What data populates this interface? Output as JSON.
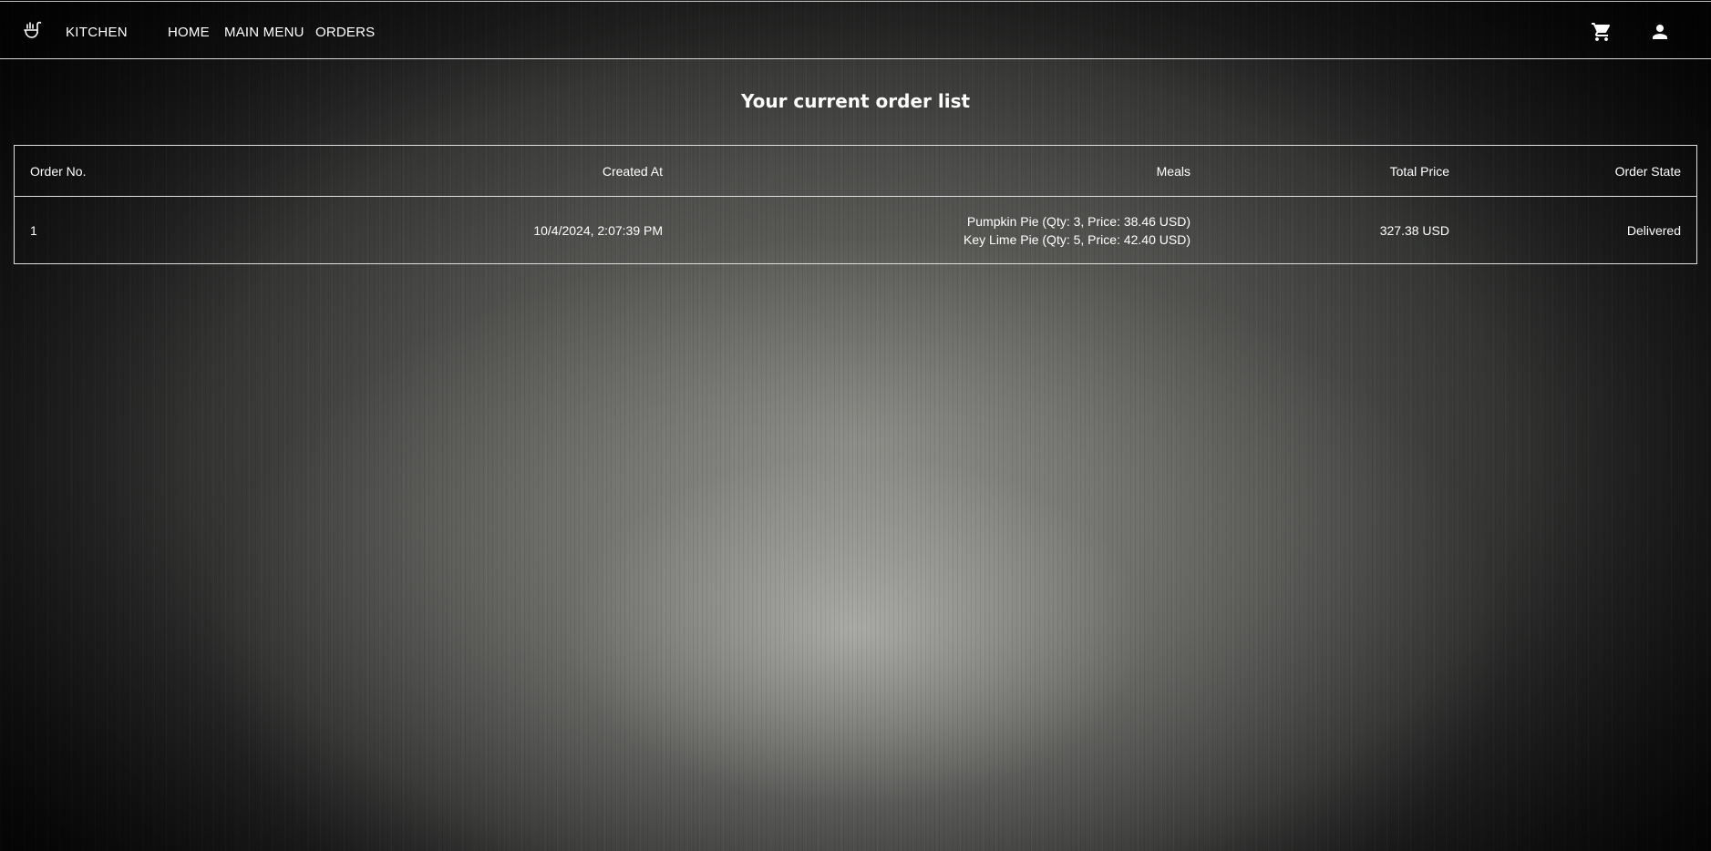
{
  "header": {
    "brand": "KITCHEN",
    "nav": [
      "HOME",
      "MAIN MENU",
      "ORDERS"
    ],
    "icons": {
      "logo": "kitchen-utensils-icon",
      "cart": "cart-icon",
      "account": "person-icon"
    }
  },
  "page": {
    "title": "Your current order list"
  },
  "table": {
    "columns": [
      "Order No.",
      "Created At",
      "Meals",
      "Total Price",
      "Order State"
    ],
    "rows": [
      {
        "order_no": "1",
        "created_at": "10/4/2024, 2:07:39 PM",
        "meals": [
          "Pumpkin Pie (Qty: 3, Price: 38.46 USD)",
          "Key Lime Pie (Qty: 5, Price: 42.40 USD)"
        ],
        "total_price": "327.38 USD",
        "state": "Delivered"
      }
    ]
  },
  "colors": {
    "text": "#ffffff",
    "border": "#e0e0e0"
  }
}
